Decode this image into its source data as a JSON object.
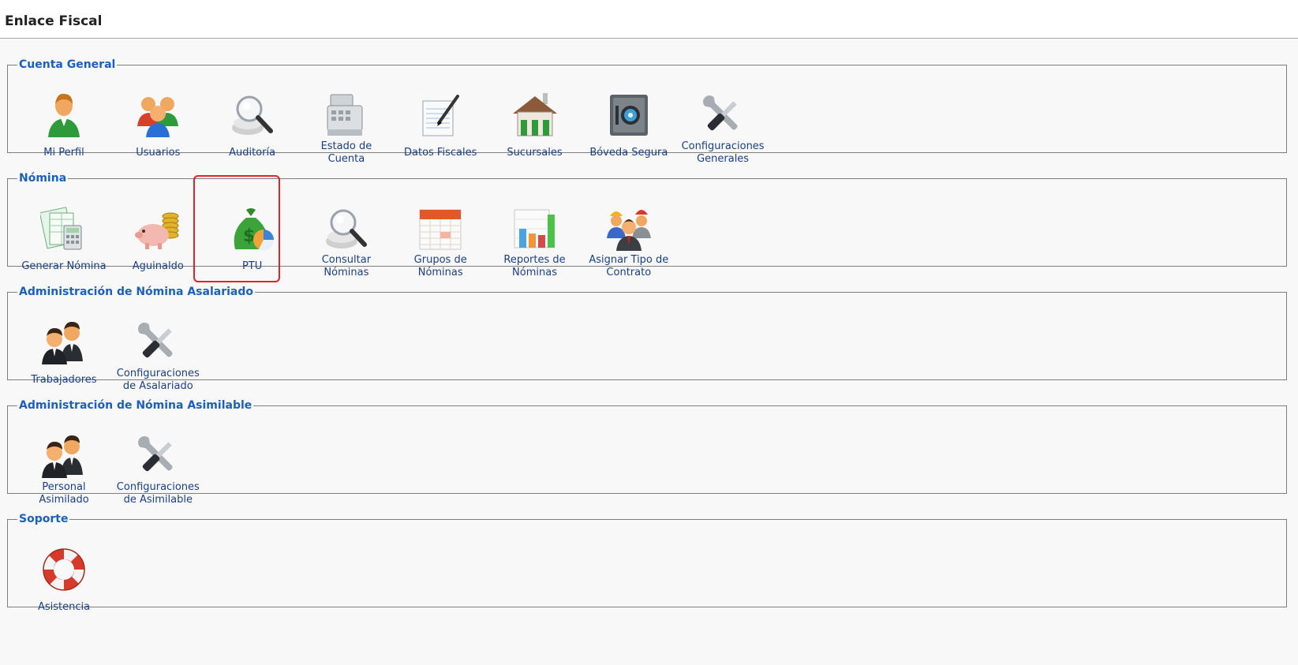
{
  "app": {
    "title": "Enlace Fiscal"
  },
  "sections": [
    {
      "title": "Cuenta General",
      "items": [
        {
          "label": "Mi Perfil",
          "icon": "user-profile-icon"
        },
        {
          "label": "Usuarios",
          "icon": "users-group-icon"
        },
        {
          "label": "Auditoría",
          "icon": "magnifier-icon"
        },
        {
          "label": "Estado de\nCuenta",
          "icon": "cash-register-icon"
        },
        {
          "label": "Datos Fiscales",
          "icon": "notepad-pen-icon"
        },
        {
          "label": "Sucursales",
          "icon": "building-icon"
        },
        {
          "label": "Bóveda Segura",
          "icon": "safe-icon"
        },
        {
          "label": "Configuraciones\nGenerales",
          "icon": "tools-icon"
        }
      ]
    },
    {
      "title": "Nómina",
      "items": [
        {
          "label": "Generar Nómina",
          "icon": "payroll-spreadsheet-icon"
        },
        {
          "label": "Aguinaldo",
          "icon": "piggy-bank-icon"
        },
        {
          "label": "PTU",
          "icon": "money-bag-chart-icon"
        },
        {
          "label": "Consultar\nNóminas",
          "icon": "magnifier-icon"
        },
        {
          "label": "Grupos de\nNóminas",
          "icon": "calendar-icon"
        },
        {
          "label": "Reportes de\nNóminas",
          "icon": "bar-chart-icon"
        },
        {
          "label": "Asignar Tipo de\nContrato",
          "icon": "workers-icon"
        }
      ]
    },
    {
      "title": "Administración de Nómina Asalariado",
      "items": [
        {
          "label": "Trabajadores",
          "icon": "business-people-icon"
        },
        {
          "label": "Configuraciones\nde Asalariado",
          "icon": "tools-icon"
        }
      ]
    },
    {
      "title": "Administración de Nómina Asimilable",
      "items": [
        {
          "label": "Personal\nAsimilado",
          "icon": "business-people-icon"
        },
        {
          "label": "Configuraciones\nde Asimilable",
          "icon": "tools-icon"
        }
      ]
    },
    {
      "title": "Soporte",
      "items": [
        {
          "label": "Asistencia",
          "icon": "lifebuoy-icon"
        }
      ]
    }
  ],
  "highlighted_item": "PTU",
  "colors": {
    "section_title": "#1b5fbf",
    "item_label": "#1a3f8a",
    "highlight": "#e0222a",
    "border": "#7d7d7d"
  }
}
